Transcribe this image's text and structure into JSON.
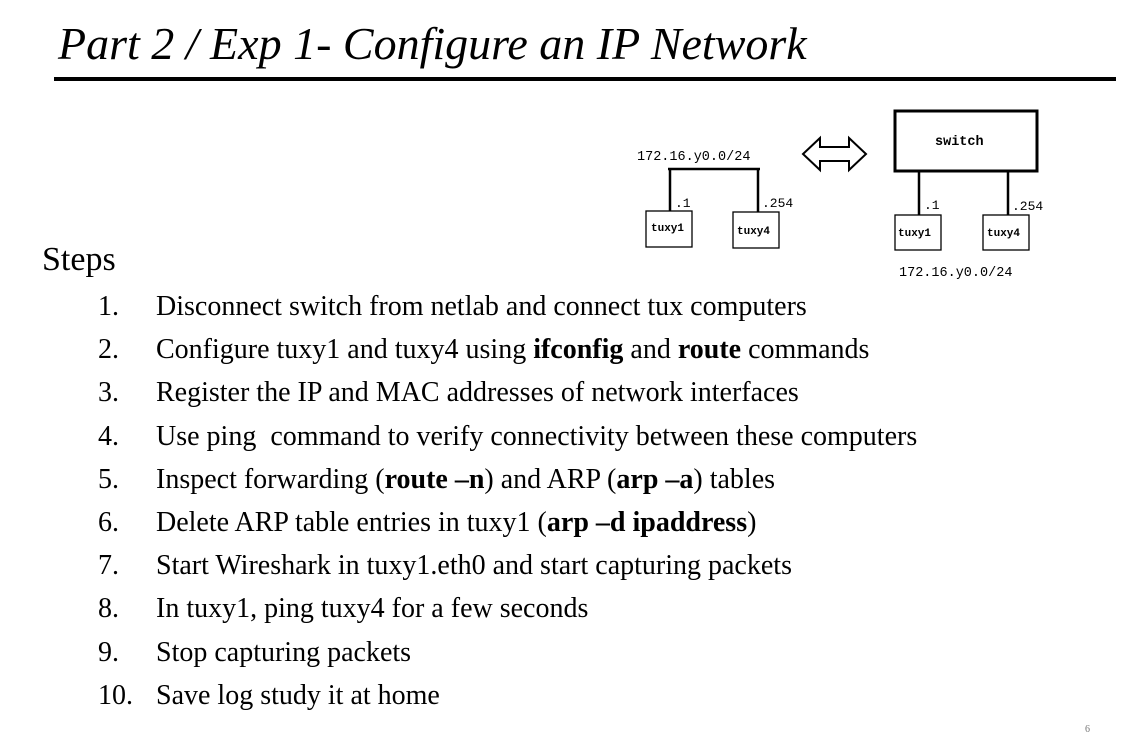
{
  "title": "Part 2 / Exp 1- Configure an IP Network",
  "diagram": {
    "left": {
      "network_label": "172.16.y0.0/24",
      "host1": {
        "name": "tuxy1",
        "addr": ".1"
      },
      "host2": {
        "name": "tuxy4",
        "addr": ".254"
      }
    },
    "right": {
      "switch_label": "switch",
      "network_label": "172.16.y0.0/24",
      "host1": {
        "name": "tuxy1",
        "addr": ".1"
      },
      "host2": {
        "name": "tuxy4",
        "addr": ".254"
      }
    }
  },
  "steps_heading": "Steps",
  "steps": [
    {
      "num": "1.",
      "parts": [
        {
          "t": "Disconnect switch from netlab and connect tux computers"
        }
      ]
    },
    {
      "num": "2.",
      "parts": [
        {
          "t": "Configure tuxy1 and tuxy4 using "
        },
        {
          "t": "ifconfig",
          "b": true
        },
        {
          "t": " and "
        },
        {
          "t": "route",
          "b": true
        },
        {
          "t": " commands"
        }
      ]
    },
    {
      "num": "3.",
      "parts": [
        {
          "t": "Register the IP and MAC addresses of network interfaces"
        }
      ]
    },
    {
      "num": "4.",
      "parts": [
        {
          "t": "Use ping  command to verify connectivity between these computers"
        }
      ]
    },
    {
      "num": "5.",
      "parts": [
        {
          "t": "Inspect forwarding ("
        },
        {
          "t": "route –n",
          "b": true
        },
        {
          "t": ") and ARP ("
        },
        {
          "t": "arp –a",
          "b": true
        },
        {
          "t": ") tables"
        }
      ]
    },
    {
      "num": "6.",
      "parts": [
        {
          "t": "Delete ARP table entries in tuxy1 ("
        },
        {
          "t": "arp –d ipaddress",
          "b": true
        },
        {
          "t": ")"
        }
      ]
    },
    {
      "num": "7.",
      "parts": [
        {
          "t": "Start Wireshark in tuxy1.eth0 and start capturing packets"
        }
      ]
    },
    {
      "num": "8.",
      "parts": [
        {
          "t": "In tuxy1, ping tuxy4 for a few seconds"
        }
      ]
    },
    {
      "num": "9.",
      "parts": [
        {
          "t": "Stop capturing packets"
        }
      ]
    },
    {
      "num": "10.",
      "parts": [
        {
          "t": "Save log study it at home"
        }
      ]
    }
  ],
  "page_mark": "6"
}
